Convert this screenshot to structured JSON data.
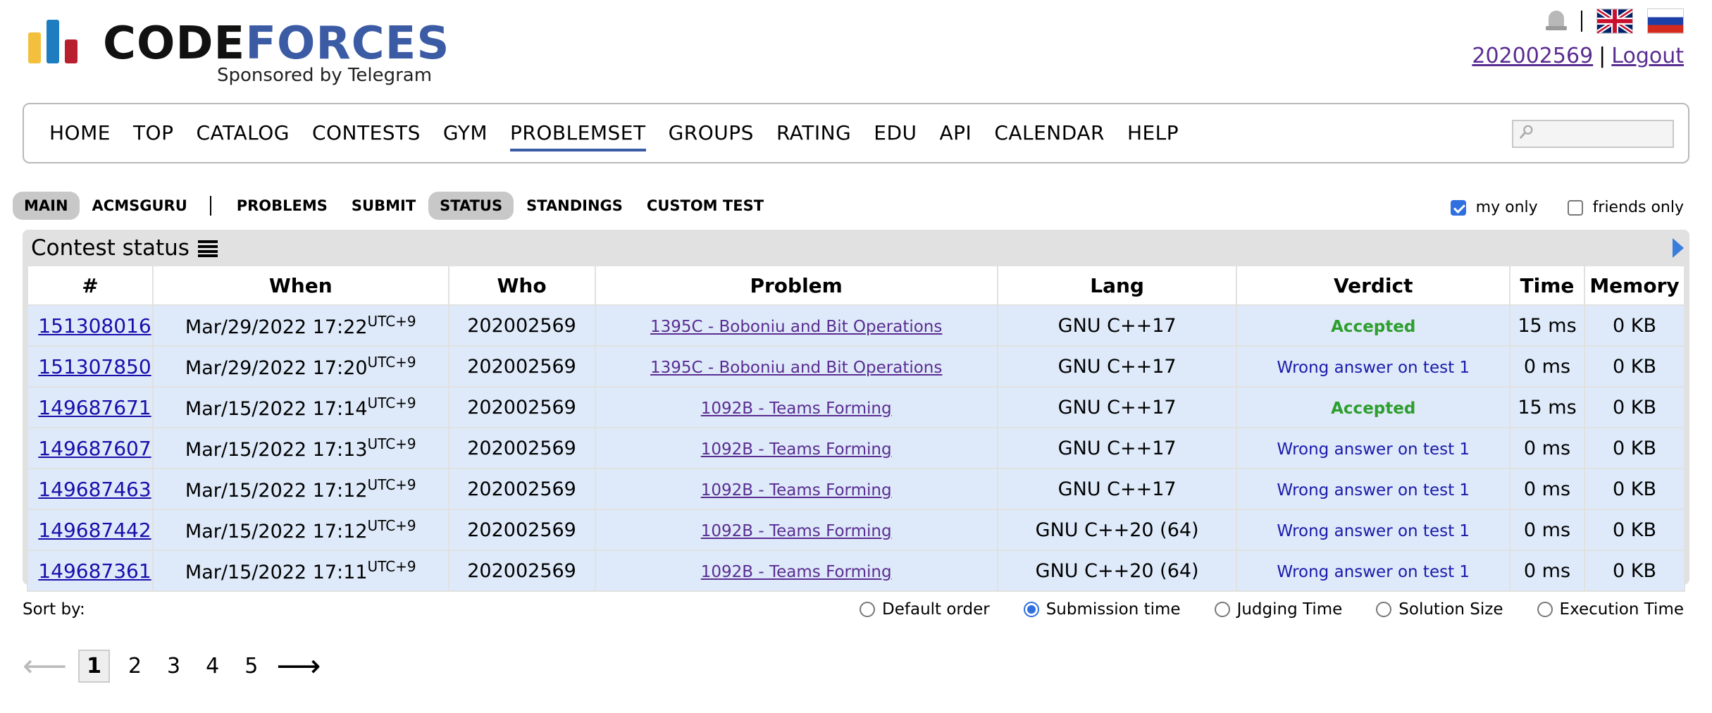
{
  "header": {
    "logo_part1": "CODE",
    "logo_part2": "FORCES",
    "sponsor": "Sponsored by Telegram",
    "username": "202002569",
    "separator": "|",
    "logout": "Logout"
  },
  "menu": {
    "items": [
      "HOME",
      "TOP",
      "CATALOG",
      "CONTESTS",
      "GYM",
      "PROBLEMSET",
      "GROUPS",
      "RATING",
      "EDU",
      "API",
      "CALENDAR",
      "HELP"
    ],
    "active": "PROBLEMSET",
    "search_placeholder": ""
  },
  "submenu": {
    "left": [
      "MAIN",
      "ACMSGURU"
    ],
    "right": [
      "PROBLEMS",
      "SUBMIT",
      "STATUS",
      "STANDINGS",
      "CUSTOM TEST"
    ]
  },
  "filters": {
    "my_only": "my only",
    "friends_only": "friends only"
  },
  "panel": {
    "title": "Contest status",
    "headers": [
      "#",
      "When",
      "Who",
      "Problem",
      "Lang",
      "Verdict",
      "Time",
      "Memory"
    ],
    "rows": [
      {
        "id": "151308016",
        "date": "Mar/29/2022 17:22",
        "tz": "UTC+9",
        "who": "202002569",
        "problem": "1395C - Boboniu and Bit Operations",
        "lang": "GNU C++17",
        "verdict": "Accepted",
        "ok": true,
        "time": "15 ms",
        "memory": "0 KB"
      },
      {
        "id": "151307850",
        "date": "Mar/29/2022 17:20",
        "tz": "UTC+9",
        "who": "202002569",
        "problem": "1395C - Boboniu and Bit Operations",
        "lang": "GNU C++17",
        "verdict": "Wrong answer on test 1",
        "ok": false,
        "time": "0 ms",
        "memory": "0 KB"
      },
      {
        "id": "149687671",
        "date": "Mar/15/2022 17:14",
        "tz": "UTC+9",
        "who": "202002569",
        "problem": "1092B - Teams Forming",
        "lang": "GNU C++17",
        "verdict": "Accepted",
        "ok": true,
        "time": "15 ms",
        "memory": "0 KB"
      },
      {
        "id": "149687607",
        "date": "Mar/15/2022 17:13",
        "tz": "UTC+9",
        "who": "202002569",
        "problem": "1092B - Teams Forming",
        "lang": "GNU C++17",
        "verdict": "Wrong answer on test 1",
        "ok": false,
        "time": "0 ms",
        "memory": "0 KB"
      },
      {
        "id": "149687463",
        "date": "Mar/15/2022 17:12",
        "tz": "UTC+9",
        "who": "202002569",
        "problem": "1092B - Teams Forming",
        "lang": "GNU C++17",
        "verdict": "Wrong answer on test 1",
        "ok": false,
        "time": "0 ms",
        "memory": "0 KB"
      },
      {
        "id": "149687442",
        "date": "Mar/15/2022 17:12",
        "tz": "UTC+9",
        "who": "202002569",
        "problem": "1092B - Teams Forming",
        "lang": "GNU C++20 (64)",
        "verdict": "Wrong answer on test 1",
        "ok": false,
        "time": "0 ms",
        "memory": "0 KB"
      },
      {
        "id": "149687361",
        "date": "Mar/15/2022 17:11",
        "tz": "UTC+9",
        "who": "202002569",
        "problem": "1092B - Teams Forming",
        "lang": "GNU C++20 (64)",
        "verdict": "Wrong answer on test 1",
        "ok": false,
        "time": "0 ms",
        "memory": "0 KB"
      }
    ]
  },
  "sort": {
    "label": "Sort by:",
    "options": [
      "Default order",
      "Submission time",
      "Judging Time",
      "Solution Size",
      "Execution Time"
    ],
    "selected": "Submission time"
  },
  "pager": {
    "pages": [
      "1",
      "2",
      "3",
      "4",
      "5"
    ],
    "current": "1",
    "prev": "⟵",
    "next": "⟶"
  },
  "colors": {
    "accent": "#3b5ba5",
    "accepted": "#2e9e2e",
    "wrong": "#1a1aaa",
    "row_bg": "#deeafa"
  },
  "icons": [
    "notification-bell-icon",
    "uk-flag-icon",
    "russia-flag-icon",
    "search-icon",
    "list-icon",
    "expand-arrow-icon"
  ]
}
